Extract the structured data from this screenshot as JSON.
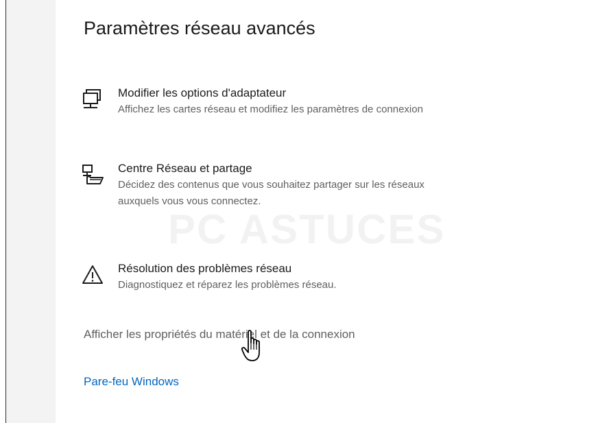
{
  "page_title": "Paramètres réseau avancés",
  "settings": [
    {
      "icon": "network-adapter-icon",
      "title": "Modifier les options d'adaptateur",
      "description": "Affichez les cartes réseau et modifiez les paramètres de connexion"
    },
    {
      "icon": "network-sharing-icon",
      "title": "Centre Réseau et partage",
      "description_line1": "Décidez des contenus que vous souhaitez partager sur les réseaux",
      "description_line2": "auxquels vous vous connectez."
    },
    {
      "icon": "warning-icon",
      "title": "Résolution des problèmes réseau",
      "description": "Diagnostiquez et réparez les problèmes réseau."
    }
  ],
  "links": {
    "hardware_properties": "Afficher les propriétés du matériel et de la connexion",
    "firewall": "Pare-feu Windows"
  },
  "watermark": "PC ASTUCES",
  "colors": {
    "link_blue": "#0067c0",
    "text_primary": "#1a1a1a",
    "text_secondary": "#5f5f5f"
  }
}
